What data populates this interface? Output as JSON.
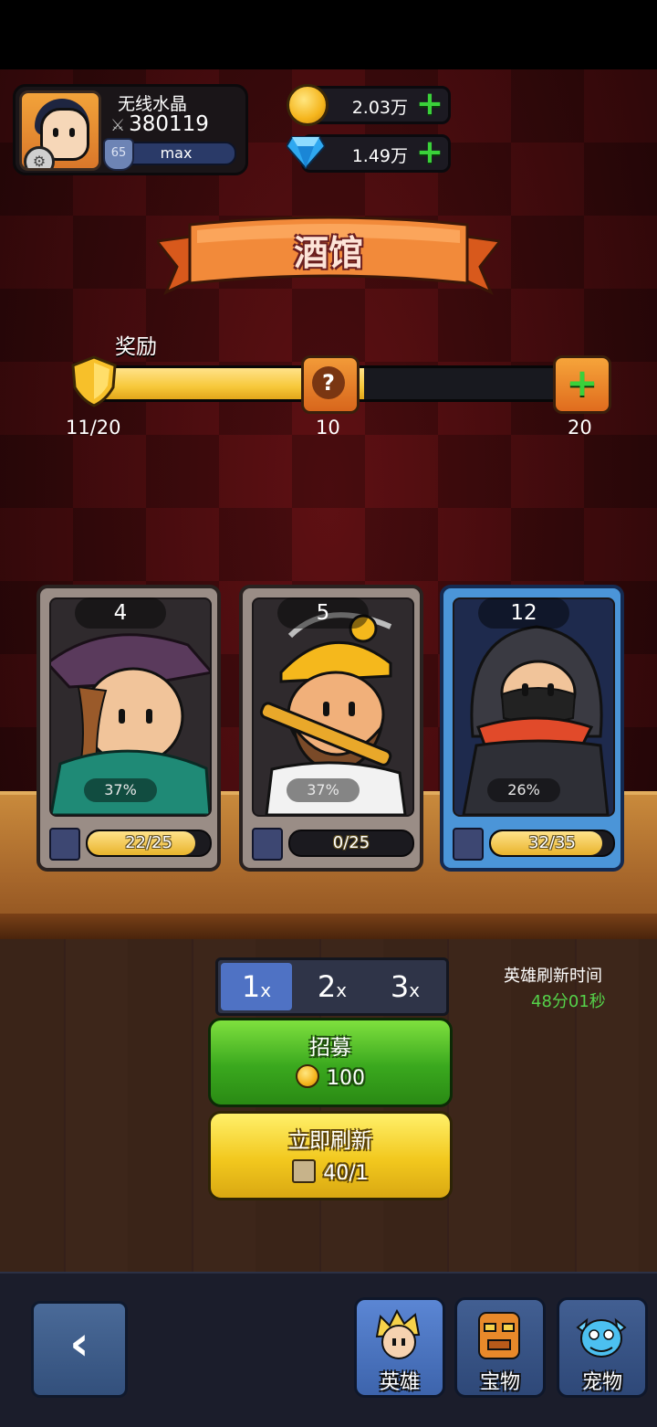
{
  "player": {
    "name": "无线水晶",
    "power": "380119",
    "level": "65",
    "vip_bar_text": "max"
  },
  "currency": {
    "gold": "2.03万",
    "diamonds": "1.49万"
  },
  "banner": {
    "title": "酒馆"
  },
  "reward_progress": {
    "label": "奖励",
    "current_text": "11/20",
    "milestone_mid": "10",
    "milestone_end": "20",
    "fill_fraction": 0.55
  },
  "cards": [
    {
      "level": "4",
      "percent": "37%",
      "progress_text": "22/25",
      "fill_fraction": 0.88
    },
    {
      "level": "5",
      "percent": "37%",
      "progress_text": "0/25",
      "fill_fraction": 0.0
    },
    {
      "level": "12",
      "percent": "26%",
      "progress_text": "32/35",
      "fill_fraction": 0.914
    }
  ],
  "multiplier": {
    "options": [
      "1",
      "2",
      "3"
    ],
    "suffix": "x",
    "selected": "1"
  },
  "refresh": {
    "label": "英雄刷新时间",
    "time": "48分01秒"
  },
  "recruit_button": {
    "label": "招募",
    "cost": "100"
  },
  "refresh_button": {
    "label": "立即刷新",
    "cost": "40/1"
  },
  "bottom_nav": {
    "back_icon": "‹",
    "items": [
      {
        "label": "英雄",
        "icon": "hero-icon",
        "selected": true
      },
      {
        "label": "宝物",
        "icon": "treasure-icon",
        "selected": false
      },
      {
        "label": "宠物",
        "icon": "pet-icon",
        "selected": false
      }
    ]
  },
  "colors": {
    "background": "#5a0f12",
    "gold_bar": "#f7c83a",
    "green_button": "#3aa81e",
    "yellow_button": "#f2c81e",
    "nav_blue": "#3d64ac",
    "card_blue": "#4b95d8"
  }
}
